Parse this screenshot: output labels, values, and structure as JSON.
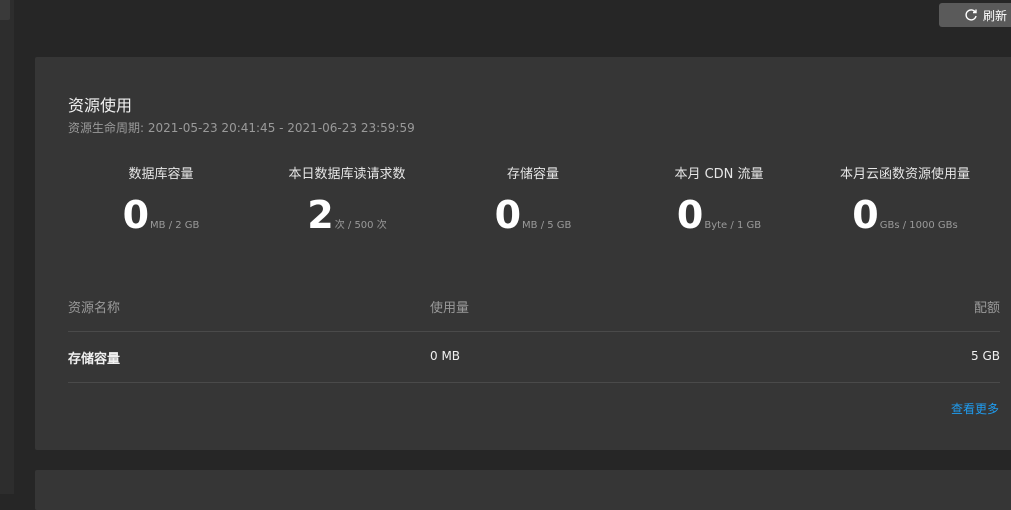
{
  "toolbar": {
    "refresh_label": "刷新"
  },
  "card": {
    "title": "资源使用",
    "lifecycle_label": "资源生命周期:",
    "lifecycle_range": "2021-05-23 20:41:45 - 2021-06-23 23:59:59"
  },
  "stats": [
    {
      "label": "数据库容量",
      "value": "0",
      "unit": "MB / 2 GB"
    },
    {
      "label": "本日数据库读请求数",
      "value": "2",
      "unit": "次 / 500 次"
    },
    {
      "label": "存储容量",
      "value": "0",
      "unit": "MB / 5 GB"
    },
    {
      "label": "本月 CDN 流量",
      "value": "0",
      "unit": "Byte / 1 GB"
    },
    {
      "label": "本月云函数资源使用量",
      "value": "0",
      "unit": "GBs / 1000 GBs"
    }
  ],
  "table": {
    "headers": {
      "name": "资源名称",
      "usage": "使用量",
      "quota": "配额"
    },
    "rows": [
      {
        "name": "存储容量",
        "usage": "0 MB",
        "quota": "5 GB"
      }
    ]
  },
  "more_link": "查看更多",
  "icons": {
    "refresh": "refresh-icon"
  },
  "colors": {
    "link": "#1f9cf0",
    "background": "#262626",
    "card": "#363636"
  }
}
